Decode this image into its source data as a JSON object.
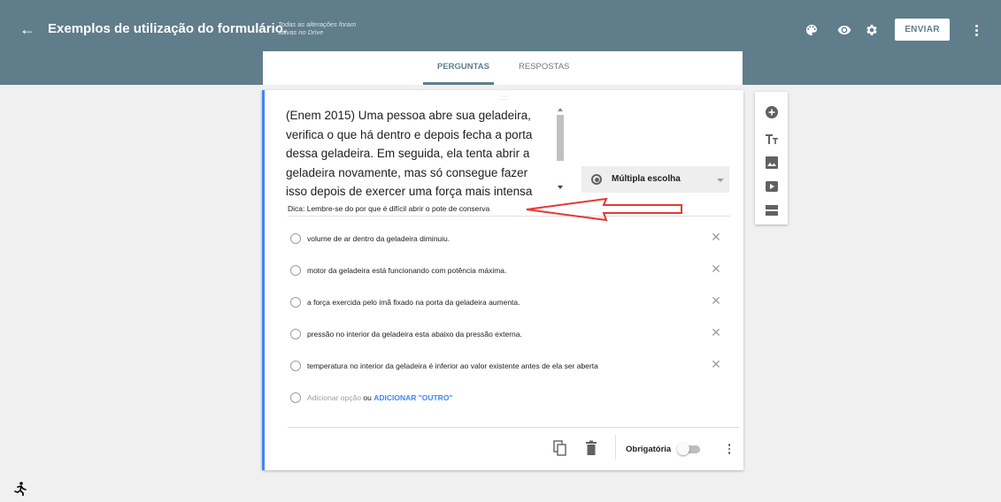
{
  "header": {
    "back_icon": "arrow-left-icon",
    "title": "Exemplos de utilização do formulário.",
    "save_status": "Todas as alterações foram salvas no Drive",
    "icons": [
      "palette-icon",
      "eye-icon",
      "gear-icon"
    ],
    "send_label": "ENVIAR",
    "more_icon": "more-vert-icon"
  },
  "tabs": [
    {
      "label": "PERGUNTAS",
      "active": true
    },
    {
      "label": "RESPOSTAS",
      "active": false
    }
  ],
  "question": {
    "drag_handle": ":::",
    "text": "(Enem 2015) Uma pessoa abre sua geladeira,\nverifica o que há dentro e depois fecha a porta\ndessa geladeira. Em seguida, ela tenta abrir a\ngeladeira novamente, mas só consegue fazer\nisso depois de exercer uma força mais intensa",
    "type_label": "Múltipla escolha",
    "hint": "Dica: Lembre-se do por que é difícil abrir o pote de conserva",
    "options": [
      "volume de ar dentro da geladeira diminuiu.",
      "motor da geladeira está funcionando com potência máxima.",
      "a força exercida pelo imã fixado na porta da geladeira aumenta.",
      "pressão no interior da geladeira esta abaixo da pressão externa.",
      "temperatura no interior da geladeira é inferior ao valor existente antes de ela ser aberta"
    ],
    "remove_glyph": "✕",
    "add_option": "Adicionar opção",
    "add_or": "ou",
    "add_other": "ADICIONAR \"OUTRO\"",
    "required_label": "Obrigatória",
    "required_on": false
  },
  "side_toolbar": [
    "add-circle-icon",
    "title-text-icon",
    "image-icon",
    "video-icon",
    "section-icon"
  ],
  "annotation": {
    "color": "#e53935"
  },
  "colors": {
    "header_bg": "#607d8b",
    "accent": "#4285f4"
  }
}
